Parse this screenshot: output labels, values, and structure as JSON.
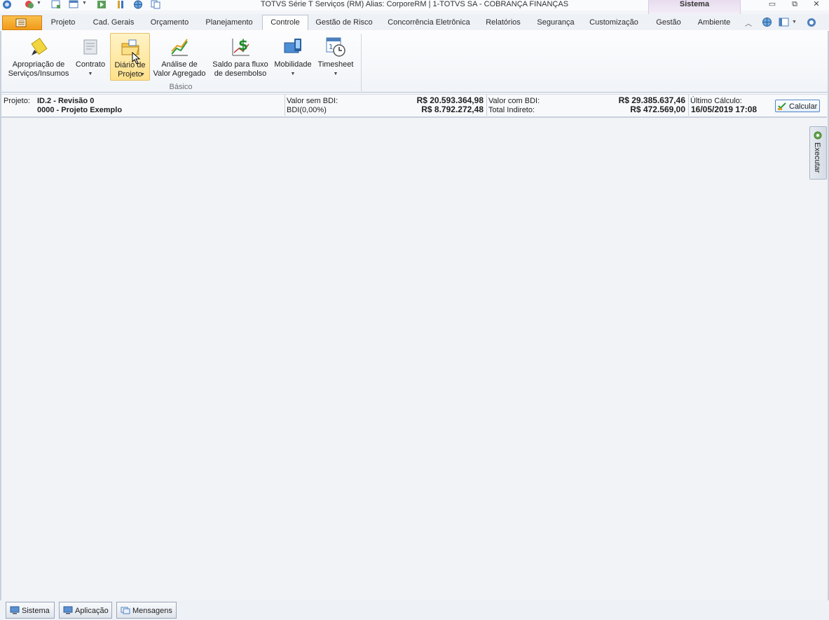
{
  "window": {
    "title": "TOTVS Série T Serviços (RM) Alias: CorporeRM | 1-TOTVS SA - COBRANÇA FINANÇAS",
    "context_tab": "Sistema",
    "controls": {
      "minimize": "▭",
      "restore": "⧉",
      "close": "✕"
    }
  },
  "quick_access": [
    "app-orb-icon",
    "user-icon",
    "new-window-icon",
    "layout-icon",
    "run-icon",
    "tools-icon",
    "globe-icon",
    "copy-icon"
  ],
  "tabs": [
    {
      "label": "Projeto",
      "active": false
    },
    {
      "label": "Cad. Gerais",
      "active": false
    },
    {
      "label": "Orçamento",
      "active": false
    },
    {
      "label": "Planejamento",
      "active": false
    },
    {
      "label": "Controle",
      "active": true
    },
    {
      "label": "Gestão de Risco",
      "active": false
    },
    {
      "label": "Concorrência Eletrônica",
      "active": false
    },
    {
      "label": "Relatórios",
      "active": false
    },
    {
      "label": "Segurança",
      "active": false
    },
    {
      "label": "Customização",
      "active": false
    },
    {
      "label": "Gestão",
      "active": false
    },
    {
      "label": "Ambiente",
      "active": false
    }
  ],
  "ribbon": {
    "group_label": "Básico",
    "buttons": [
      {
        "label": "Apropriação de\nServiços/Insumos",
        "icon": "pencil-icon",
        "dropdown": false
      },
      {
        "label": "Contrato",
        "icon": "contract-icon",
        "dropdown": true
      },
      {
        "label": "Diário de\nProjeto",
        "icon": "folder-icon",
        "dropdown": true
      },
      {
        "label": "Análise de\nValor Agregado",
        "icon": "chart-icon",
        "dropdown": false
      },
      {
        "label": "Saldo para fluxo\nde desembolso",
        "icon": "dollar-icon",
        "dropdown": false
      },
      {
        "label": "Mobilidade",
        "icon": "mobile-icon",
        "dropdown": true
      },
      {
        "label": "Timesheet",
        "icon": "calendar-clock-icon",
        "dropdown": true
      }
    ]
  },
  "project_info": {
    "project_label": "Projeto:",
    "project_id": "ID.2 - Revisão 0",
    "project_name": "0000 - Projeto Exemplo",
    "valor_sem_bdi_label": "Valor sem BDI:",
    "valor_sem_bdi": "R$ 20.593.364,98",
    "bdi_label": "BDI(0,00%)",
    "bdi_value": "R$ 8.792.272,48",
    "valor_com_bdi_label": "Valor com BDI:",
    "valor_com_bdi": "R$ 29.385.637,46",
    "total_indireto_label": "Total Indireto:",
    "total_indireto": "R$ 472.569,00",
    "ultimo_calculo_label": "Último Cálculo:",
    "ultimo_calculo": "16/05/2019 17:08",
    "calcular_label": "Calcular"
  },
  "side_panel": {
    "label": "Executar"
  },
  "bottom_tabs": [
    {
      "label": "Sistema",
      "icon": "monitor-icon"
    },
    {
      "label": "Aplicação",
      "icon": "monitor-icon"
    },
    {
      "label": "Mensagens",
      "icon": "messages-icon"
    }
  ],
  "colors": {
    "accent": "#f19a17",
    "hover": "#ffe08a",
    "active_tab_border": "#b9c4d4",
    "button_border": "#4f86c6"
  }
}
